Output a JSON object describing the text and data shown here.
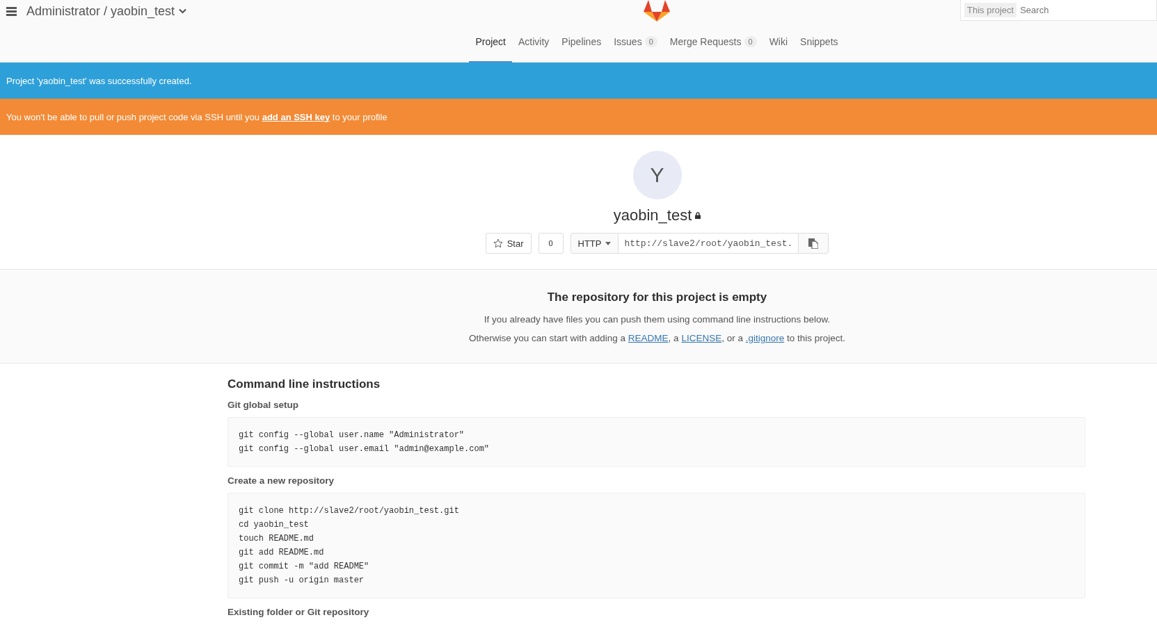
{
  "header": {
    "breadcrumb": "Administrator / yaobin_test",
    "search": {
      "scope": "This project",
      "placeholder": "Search"
    }
  },
  "tabs": [
    {
      "label": "Project",
      "selected": true
    },
    {
      "label": "Activity",
      "selected": false
    },
    {
      "label": "Pipelines",
      "selected": false
    },
    {
      "label": "Issues",
      "count": "0",
      "selected": false
    },
    {
      "label": "Merge Requests",
      "count": "0",
      "selected": false
    },
    {
      "label": "Wiki",
      "selected": false
    },
    {
      "label": "Snippets",
      "selected": false
    }
  ],
  "alerts": [
    {
      "kind": "notice",
      "parts": [
        {
          "text": "Project 'yaobin_test' was successfully created."
        }
      ]
    },
    {
      "kind": "warning",
      "parts": [
        {
          "text": "You won't be able to pull or push project code via SSH until you "
        },
        {
          "text": "add an SSH key",
          "link": true
        },
        {
          "text": " to your profile"
        }
      ]
    }
  ],
  "project": {
    "avatar_letter": "Y",
    "name": "yaobin_test",
    "star_label": "Star",
    "star_count": "0",
    "protocol": "HTTP",
    "clone_url": "http://slave2/root/yaobin_test."
  },
  "empty_repo": {
    "title": "The repository for this project is empty",
    "line1": "If you already have files you can push them using command line instructions below.",
    "line2": [
      {
        "text": "Otherwise you can start with adding a "
      },
      {
        "text": "README",
        "link": true
      },
      {
        "text": ", a "
      },
      {
        "text": "LICENSE",
        "link": true
      },
      {
        "text": ", or a "
      },
      {
        "text": ".gitignore",
        "link": true
      },
      {
        "text": " to this project."
      }
    ]
  },
  "instructions": {
    "title": "Command line instructions",
    "sections": [
      {
        "heading": "Git global setup",
        "lines": [
          "git config --global user.name \"Administrator\"",
          "git config --global user.email \"admin@example.com\""
        ]
      },
      {
        "heading": "Create a new repository",
        "lines": [
          "git clone http://slave2/root/yaobin_test.git",
          "cd yaobin_test",
          "touch README.md",
          "git add README.md",
          "git commit -m \"add README\"",
          "git push -u origin master"
        ]
      },
      {
        "heading": "Existing folder or Git repository"
      }
    ]
  }
}
